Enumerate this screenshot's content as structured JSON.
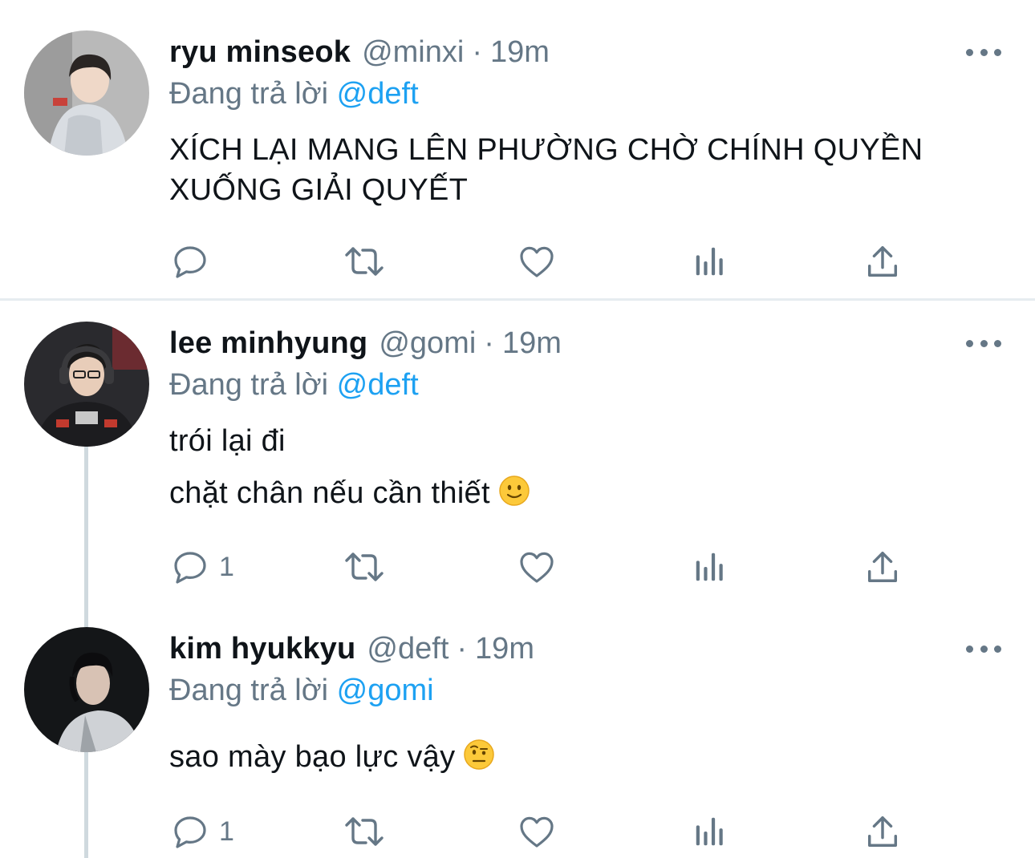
{
  "tweets": [
    {
      "display_name": "ryu minseok",
      "handle": "@minxi",
      "separator": "·",
      "time": "19m",
      "reply_prefix": "Đang trả lời",
      "reply_to": "@deft",
      "lines": [
        "XÍCH LẠI MANG LÊN PHƯỜNG CHỜ CHÍNH QUYỀN",
        "XUỐNG GIẢI QUYẾT"
      ],
      "reply_count": "",
      "avatar_icon": "avatar-photo"
    },
    {
      "display_name": "lee minhyung",
      "handle": "@gomi",
      "separator": "·",
      "time": "19m",
      "reply_prefix": "Đang trả lời",
      "reply_to": "@deft",
      "lines": [
        "trói lại đi",
        "chặt chân nếu cần thiết"
      ],
      "emoji": "slightly-smiling-face",
      "reply_count": "1",
      "avatar_icon": "avatar-photo"
    },
    {
      "display_name": "kim hyukkyu",
      "handle": "@deft",
      "separator": "·",
      "time": "19m",
      "reply_prefix": "Đang trả lời",
      "reply_to": "@gomi",
      "lines": [
        "sao mày bạo lực vậy"
      ],
      "emoji": "face-with-raised-eyebrow",
      "reply_count": "1",
      "avatar_icon": "avatar-photo"
    }
  ],
  "action_icons": [
    "reply-icon",
    "retweet-icon",
    "like-icon",
    "analytics-icon",
    "share-icon"
  ],
  "colors": {
    "text": "#0f1419",
    "secondary": "#657786",
    "link": "#1da1f2",
    "divider": "#e6ecf0",
    "thread_line": "#cfd9de"
  }
}
